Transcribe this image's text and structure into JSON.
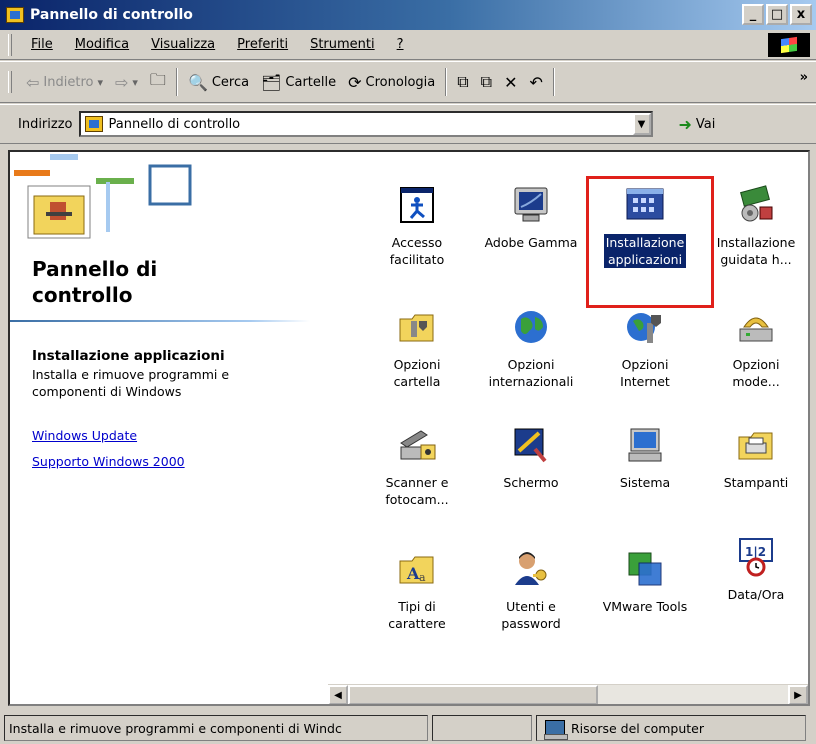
{
  "window": {
    "title": "Pannello di controllo",
    "controls": {
      "minimize": "_",
      "maximize": "□",
      "close": "x"
    }
  },
  "menu": {
    "items": [
      {
        "label": "File",
        "accel": "F"
      },
      {
        "label": "Modifica",
        "accel": "M"
      },
      {
        "label": "Visualizza",
        "accel": "V"
      },
      {
        "label": "Preferiti",
        "accel": "P"
      },
      {
        "label": "Strumenti",
        "accel": "S"
      },
      {
        "label": "?",
        "accel": "?"
      }
    ]
  },
  "toolbar": {
    "back": "Indietro",
    "search": "Cerca",
    "folders": "Cartelle",
    "history": "Cronologia",
    "more": "»"
  },
  "address": {
    "label": "Indirizzo",
    "value": "Pannello di controllo",
    "go": "Vai"
  },
  "leftpanel": {
    "title_line1": "Pannello di",
    "title_line2": "controllo",
    "desc_title": "Installazione applicazioni",
    "desc_text": "Installa e rimuove programmi e componenti di Windows",
    "links": [
      "Windows Update",
      "Supporto Windows 2000"
    ]
  },
  "icons": [
    {
      "label1": "Accesso",
      "label2": "facilitato",
      "icon": "accessibility-icon"
    },
    {
      "label1": "Adobe Gamma",
      "label2": "",
      "icon": "monitor-gamma-icon"
    },
    {
      "label1": "Installazione",
      "label2": "applicazioni",
      "icon": "add-remove-programs-icon",
      "selected": true
    },
    {
      "label1": "Installazione",
      "label2": "guidata h...",
      "icon": "add-hardware-icon"
    },
    {
      "label1": "Opzioni",
      "label2": "cartella",
      "icon": "folder-options-icon"
    },
    {
      "label1": "Opzioni",
      "label2": "internazionali",
      "icon": "globe-icon"
    },
    {
      "label1": "Opzioni",
      "label2": "Internet",
      "icon": "internet-options-icon"
    },
    {
      "label1": "Opzioni",
      "label2": "mode...",
      "icon": "modem-icon"
    },
    {
      "label1": "Scanner e",
      "label2": "fotocam...",
      "icon": "scanner-icon"
    },
    {
      "label1": "Schermo",
      "label2": "",
      "icon": "display-icon"
    },
    {
      "label1": "Sistema",
      "label2": "",
      "icon": "computer-icon"
    },
    {
      "label1": "Stampanti",
      "label2": "",
      "icon": "printers-icon"
    },
    {
      "label1": "Tipi di",
      "label2": "carattere",
      "icon": "fonts-icon"
    },
    {
      "label1": "Utenti e",
      "label2": "password",
      "icon": "users-icon"
    },
    {
      "label1": "VMware Tools",
      "label2": "",
      "icon": "vmware-icon"
    },
    {
      "label1": "Data/Ora",
      "label2": "",
      "icon": "clock-icon"
    }
  ],
  "statusbar": {
    "left": "Installa e rimuove programmi e componenti di Windc",
    "right": "Risorse del computer"
  },
  "colors": {
    "selection": "#0a246a",
    "highlight_border": "#e0201a",
    "link": "#0000cc",
    "face": "#d4d0c8"
  }
}
